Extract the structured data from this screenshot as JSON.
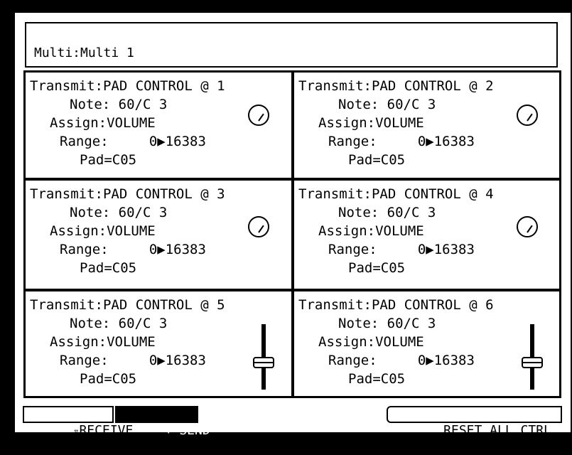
{
  "header": {
    "title": "Multi:Multi  1"
  },
  "panels": [
    {
      "transmit": "Transmit:PAD CONTROL @ 1",
      "note": "Note: 60/C 3",
      "assign": "Assign:VOLUME",
      "range": "Range:     0▶16383",
      "pad": "Pad=C05",
      "control": "knob-icon"
    },
    {
      "transmit": "Transmit:PAD CONTROL @ 2",
      "note": "Note: 60/C 3",
      "assign": "Assign:VOLUME",
      "range": "Range:     0▶16383",
      "pad": "Pad=C05",
      "control": "knob-icon"
    },
    {
      "transmit": "Transmit:PAD CONTROL @ 3",
      "note": "Note: 60/C 3",
      "assign": "Assign:VOLUME",
      "range": "Range:     0▶16383",
      "pad": "Pad=C05",
      "control": "knob-icon"
    },
    {
      "transmit": "Transmit:PAD CONTROL @ 4",
      "note": "Note: 60/C 3",
      "assign": "Assign:VOLUME",
      "range": "Range:     0▶16383",
      "pad": "Pad=C05",
      "control": "knob-icon"
    },
    {
      "transmit": "Transmit:PAD CONTROL @ 5",
      "note": "Note: 60/C 3",
      "assign": "Assign:VOLUME",
      "range": "Range:     0▶16383",
      "pad": "Pad=C05",
      "control": "fader-icon"
    },
    {
      "transmit": "Transmit:PAD CONTROL @ 6",
      "note": "Note: 60/C 3",
      "assign": "Assign:VOLUME",
      "range": "Range:     0▶16383",
      "pad": "Pad=C05",
      "control": "fader-icon"
    }
  ],
  "bottom": {
    "receive_label": "RECEIVE",
    "send_label": "SEND",
    "reset_label": "RESET ALL CTRL"
  },
  "colors": {
    "background": "#000000",
    "screen": "#ffffff",
    "ink": "#000000"
  }
}
